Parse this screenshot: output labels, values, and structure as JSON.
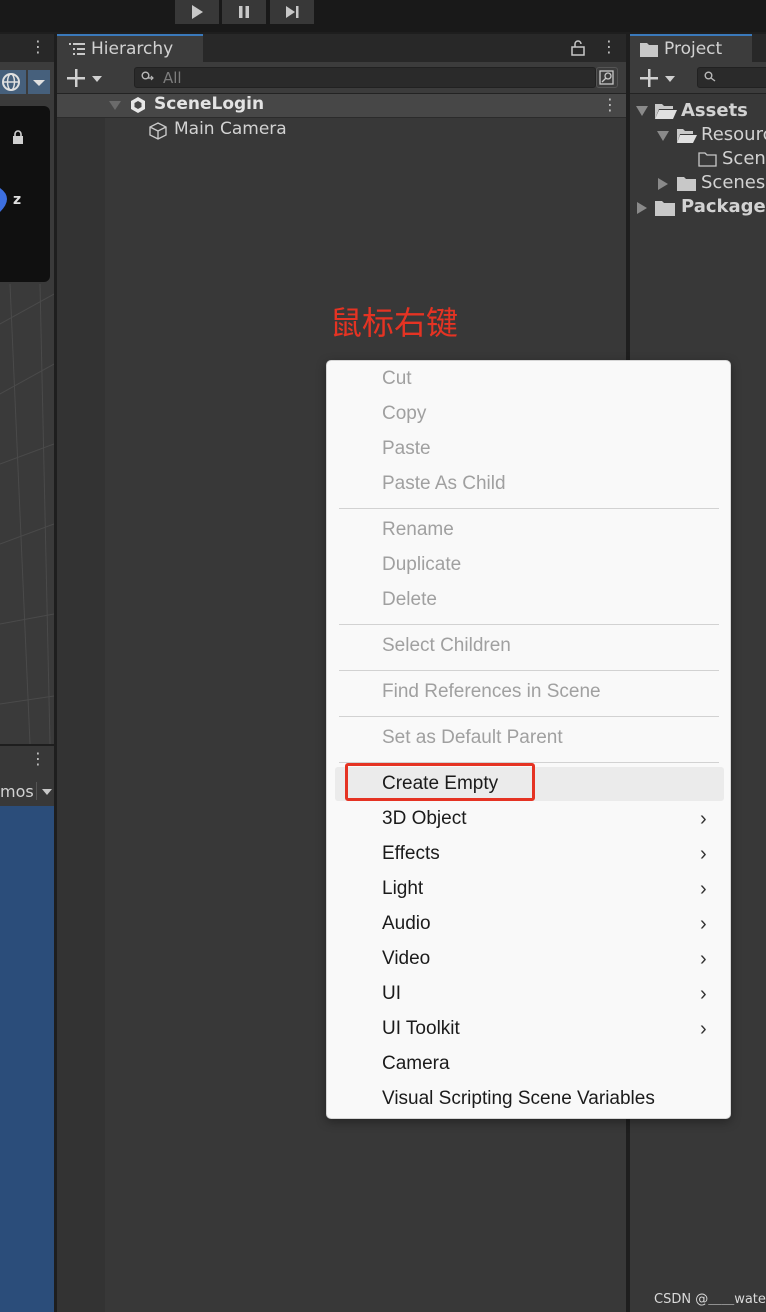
{
  "toolbar": {
    "play_icon": "play-icon",
    "pause_icon": "pause-icon",
    "step_icon": "step-icon"
  },
  "scene_panel": {
    "axis_label": "z",
    "gizmos_label": "mos"
  },
  "hierarchy": {
    "tab_title": "Hierarchy",
    "search_placeholder": "All",
    "scene_name": "SceneLogin",
    "children": [
      {
        "label": "Main Camera"
      }
    ]
  },
  "project": {
    "tab_title": "Project",
    "tree": [
      {
        "label": "Assets"
      },
      {
        "label": "Resourc"
      },
      {
        "label": "Scen"
      },
      {
        "label": "Scenes"
      },
      {
        "label": "Packages"
      }
    ]
  },
  "annotation": "鼠标右键",
  "context_menu": {
    "items": [
      {
        "label": "Cut",
        "enabled": false
      },
      {
        "label": "Copy",
        "enabled": false
      },
      {
        "label": "Paste",
        "enabled": false
      },
      {
        "label": "Paste As Child",
        "enabled": false
      },
      {
        "label": "Rename",
        "enabled": false
      },
      {
        "label": "Duplicate",
        "enabled": false
      },
      {
        "label": "Delete",
        "enabled": false
      },
      {
        "label": "Select Children",
        "enabled": false
      },
      {
        "label": "Find References in Scene",
        "enabled": false
      },
      {
        "label": "Set as Default Parent",
        "enabled": false
      },
      {
        "label": "Create Empty",
        "enabled": true,
        "highlighted": true
      },
      {
        "label": "3D Object",
        "enabled": true,
        "submenu": true
      },
      {
        "label": "Effects",
        "enabled": true,
        "submenu": true
      },
      {
        "label": "Light",
        "enabled": true,
        "submenu": true
      },
      {
        "label": "Audio",
        "enabled": true,
        "submenu": true
      },
      {
        "label": "Video",
        "enabled": true,
        "submenu": true
      },
      {
        "label": "UI",
        "enabled": true,
        "submenu": true
      },
      {
        "label": "UI Toolkit",
        "enabled": true,
        "submenu": true
      },
      {
        "label": "Camera",
        "enabled": true
      },
      {
        "label": "Visual Scripting Scene Variables",
        "enabled": true
      }
    ],
    "submenu_glyph": "›"
  },
  "watermark": "CSDN @＿＿wate",
  "colors": {
    "accent": "#3a79bb",
    "annotation_red": "#e53323",
    "menu_bg": "#f9f9f9"
  }
}
